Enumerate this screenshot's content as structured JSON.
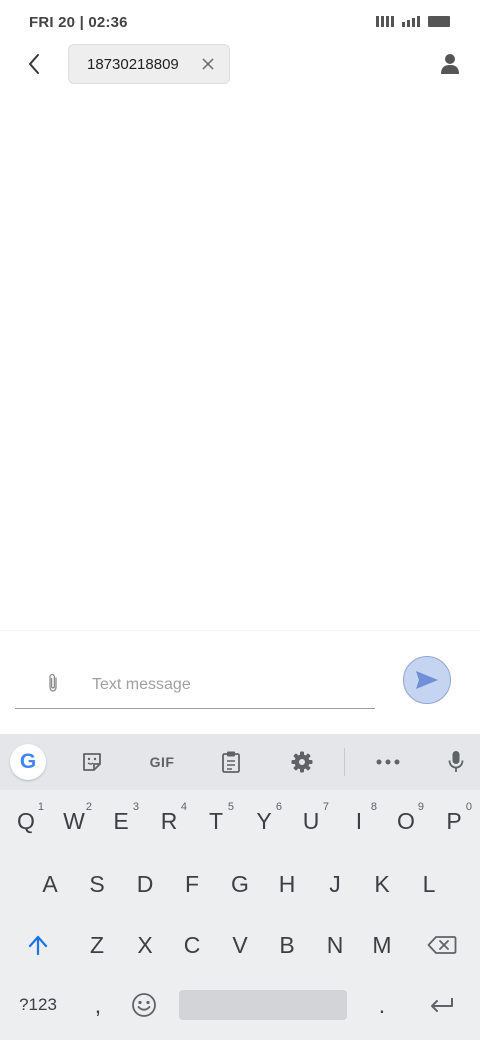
{
  "status": {
    "time": "FRI 20 | 02:36"
  },
  "header": {
    "recipient": "18730218809"
  },
  "compose": {
    "placeholder": "Text message",
    "value": ""
  },
  "keyboard": {
    "toolbar_gif": "GIF",
    "google_letter": "G",
    "row1": [
      {
        "label": "Q",
        "hint": "1"
      },
      {
        "label": "W",
        "hint": "2"
      },
      {
        "label": "E",
        "hint": "3"
      },
      {
        "label": "R",
        "hint": "4"
      },
      {
        "label": "T",
        "hint": "5"
      },
      {
        "label": "Y",
        "hint": "6"
      },
      {
        "label": "U",
        "hint": "7"
      },
      {
        "label": "I",
        "hint": "8"
      },
      {
        "label": "O",
        "hint": "9"
      },
      {
        "label": "P",
        "hint": "0"
      }
    ],
    "row2": [
      "A",
      "S",
      "D",
      "F",
      "G",
      "H",
      "J",
      "K",
      "L"
    ],
    "row3": [
      "Z",
      "X",
      "C",
      "V",
      "B",
      "N",
      "M"
    ],
    "symbols_label": "?123",
    "comma_label": ",",
    "period_label": "."
  },
  "colors": {
    "send_fill": "#c5d4f0",
    "send_arrow": "#6f8fd8",
    "shift_accent": "#1a73e8",
    "google_blue": "#4285f4"
  },
  "icons": {
    "back": "chevron-left-icon",
    "clear_recipient": "close-icon",
    "contact": "person-icon",
    "attach": "paperclip-icon",
    "send": "send-icon",
    "sticker": "sticker-icon",
    "clipboard": "clipboard-icon",
    "settings": "gear-icon",
    "more": "more-horizontal-icon",
    "mic": "microphone-icon",
    "shift": "shift-arrow-icon",
    "backspace": "backspace-icon",
    "emoji": "emoji-icon",
    "enter": "enter-icon"
  }
}
